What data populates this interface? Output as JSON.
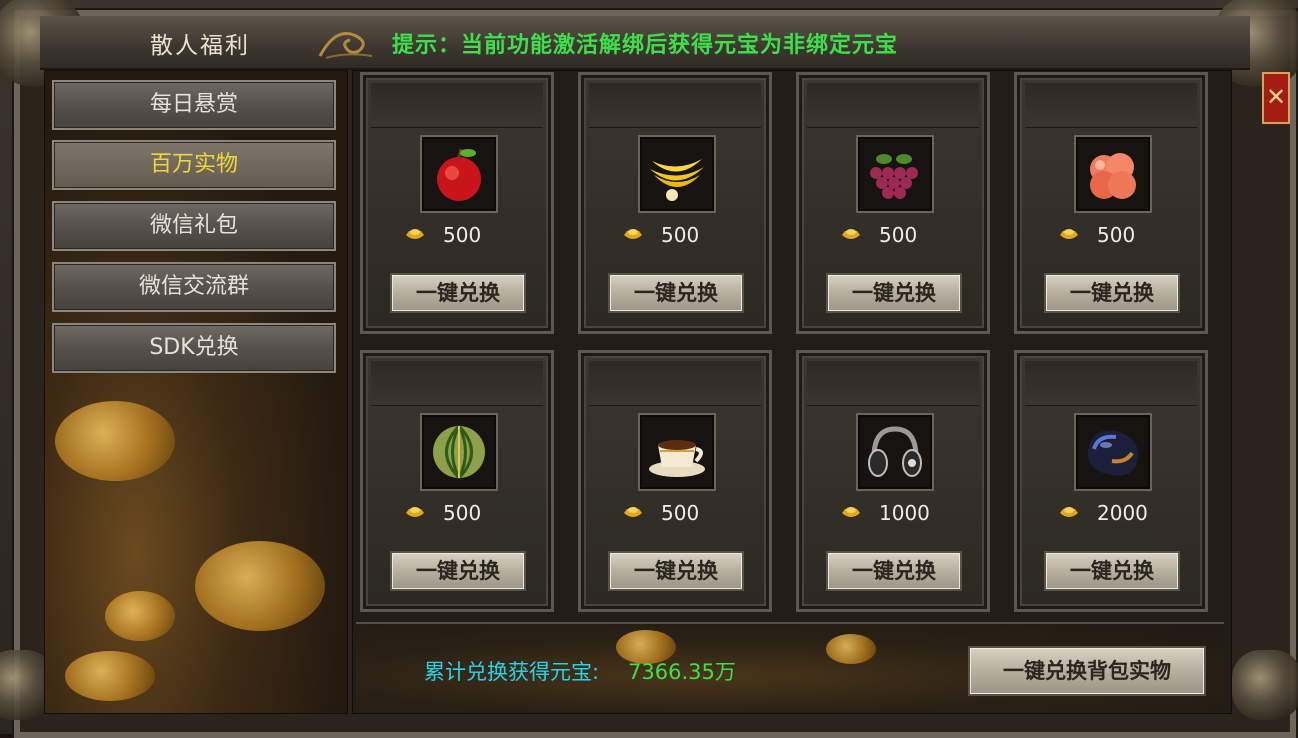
{
  "window": {
    "title": "散人福利",
    "notice": "提示：当前功能激活解绑后获得元宝为非绑定元宝"
  },
  "sidebar": {
    "items": [
      {
        "label": "每日悬赏",
        "active": false
      },
      {
        "label": "百万实物",
        "active": true
      },
      {
        "label": "微信礼包",
        "active": false
      },
      {
        "label": "微信交流群",
        "active": false
      },
      {
        "label": "SDK兑换",
        "active": false
      }
    ]
  },
  "cards": [
    {
      "item": "apple-icon",
      "price": "500",
      "button": "一键兑换"
    },
    {
      "item": "banana-icon",
      "price": "500",
      "button": "一键兑换"
    },
    {
      "item": "grapes-icon",
      "price": "500",
      "button": "一键兑换"
    },
    {
      "item": "peach-icon",
      "price": "500",
      "button": "一键兑换"
    },
    {
      "item": "melon-icon",
      "price": "500",
      "button": "一键兑换"
    },
    {
      "item": "coffee-cup-icon",
      "price": "500",
      "button": "一键兑换"
    },
    {
      "item": "headphones-icon",
      "price": "1000",
      "button": "一键兑换"
    },
    {
      "item": "mouse-icon",
      "price": "2000",
      "button": "一键兑换"
    }
  ],
  "footer": {
    "total_label": "累计兑换获得元宝:",
    "total_value": "7366.35万",
    "bag_button": "一键兑换背包实物"
  },
  "colors": {
    "notice": "#3ee04a",
    "active_tab": "#f3d53a",
    "total_label": "#27d3e8",
    "total_value": "#3ee04a",
    "close_bg": "#a31d12"
  }
}
